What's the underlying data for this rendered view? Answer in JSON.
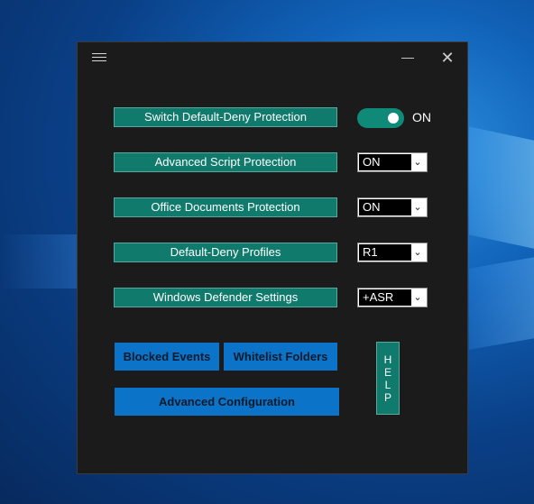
{
  "window": {
    "menu_icon": "hamburger-icon",
    "minimize_glyph": "—",
    "close_glyph": "✕"
  },
  "settings": {
    "switch_label": "Switch Default-Deny Protection",
    "switch_state": "ON",
    "rows": [
      {
        "label": "Advanced Script Protection",
        "value": "ON"
      },
      {
        "label": "Office Documents Protection",
        "value": "ON"
      },
      {
        "label": "Default-Deny Profiles",
        "value": "R1"
      },
      {
        "label": "Windows Defender Settings",
        "value": "+ASR"
      }
    ]
  },
  "actions": {
    "blocked_events": "Blocked Events",
    "whitelist_folders": "Whitelist Folders",
    "advanced_configuration": "Advanced Configuration",
    "help_letters": [
      "H",
      "E",
      "L",
      "P"
    ]
  },
  "colors": {
    "teal": "#107a6d",
    "blue": "#0b74c9",
    "window_bg": "#1b1b1b"
  }
}
